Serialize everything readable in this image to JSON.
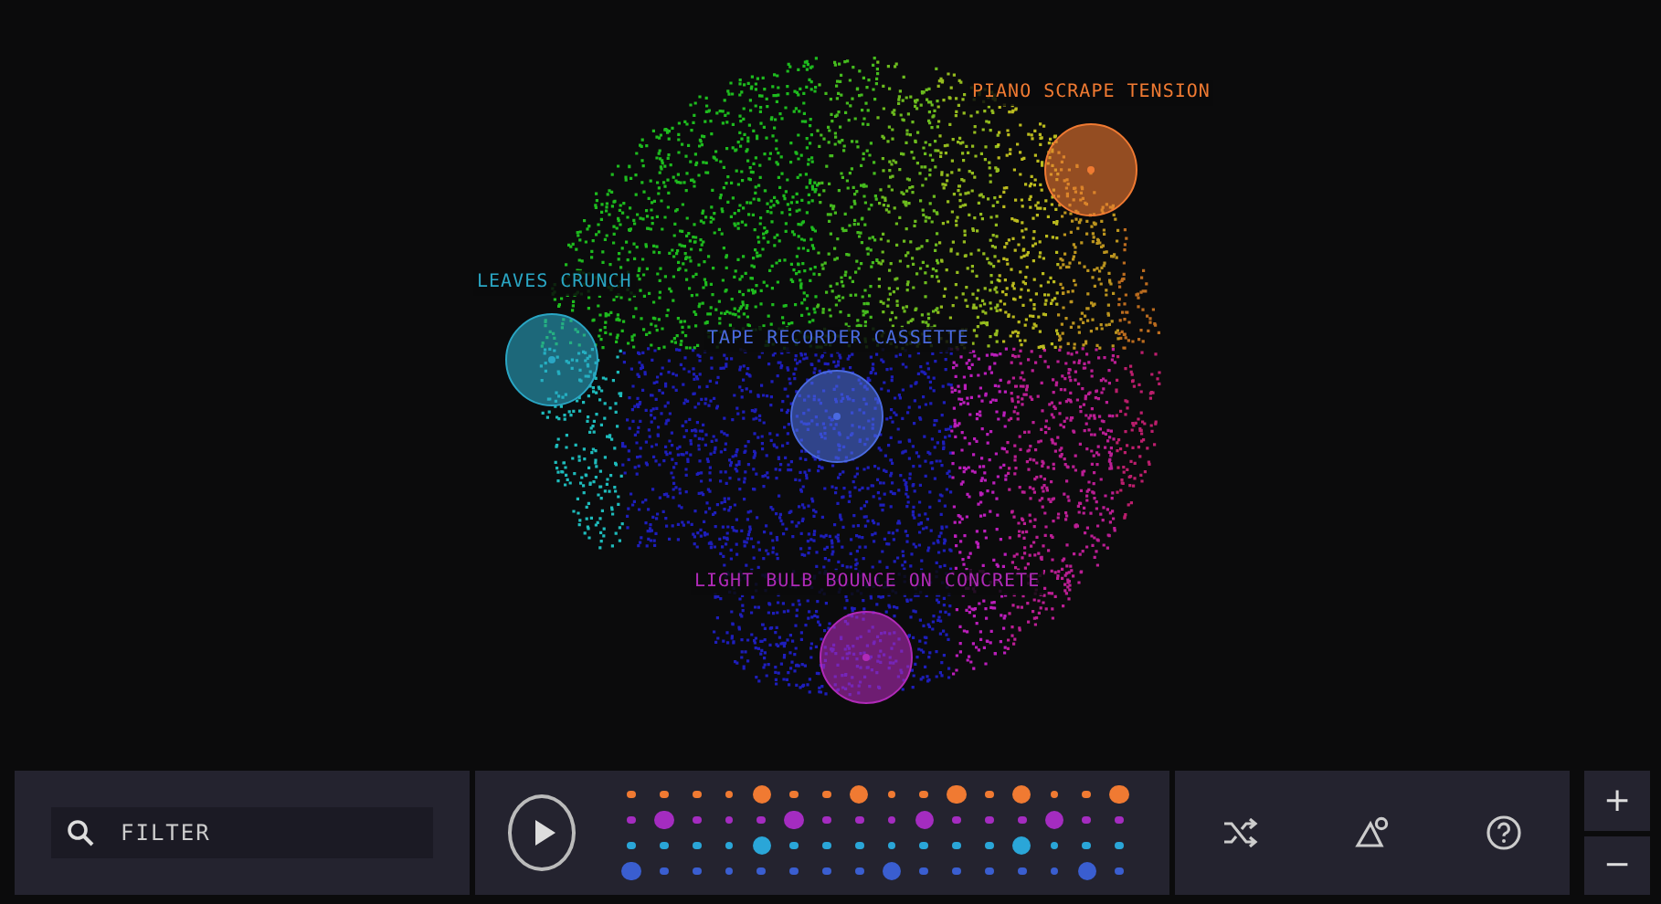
{
  "sounds": [
    {
      "label": "PIANO SCRAPE TENSION",
      "color": "#f07a32"
    },
    {
      "label": "LEAVES CRUNCH",
      "color": "#2aa6c4"
    },
    {
      "label": "TAPE RECORDER CASSETTE",
      "color": "#4a6ae0"
    },
    {
      "label": "LIGHT BULB BOUNCE ON CONCRETE",
      "color": "#b02ab8"
    }
  ],
  "filter": {
    "placeholder": "FILTER"
  },
  "sequencer": {
    "rows": [
      {
        "color": "#f07a32",
        "steps": [
          false,
          false,
          false,
          false,
          true,
          false,
          false,
          true,
          false,
          false,
          true,
          false,
          true,
          false,
          false,
          true
        ]
      },
      {
        "color": "#a42cc0",
        "steps": [
          false,
          true,
          false,
          false,
          false,
          true,
          false,
          false,
          false,
          true,
          false,
          false,
          false,
          true,
          false,
          false
        ]
      },
      {
        "color": "#2aa6d8",
        "steps": [
          false,
          false,
          false,
          false,
          true,
          false,
          false,
          false,
          false,
          false,
          false,
          false,
          true,
          false,
          false,
          false
        ]
      },
      {
        "color": "#3a5ed0",
        "steps": [
          true,
          false,
          false,
          false,
          false,
          false,
          false,
          false,
          true,
          false,
          false,
          false,
          false,
          false,
          true,
          false
        ]
      }
    ]
  },
  "zoom": {
    "in": "+",
    "out": "−"
  }
}
